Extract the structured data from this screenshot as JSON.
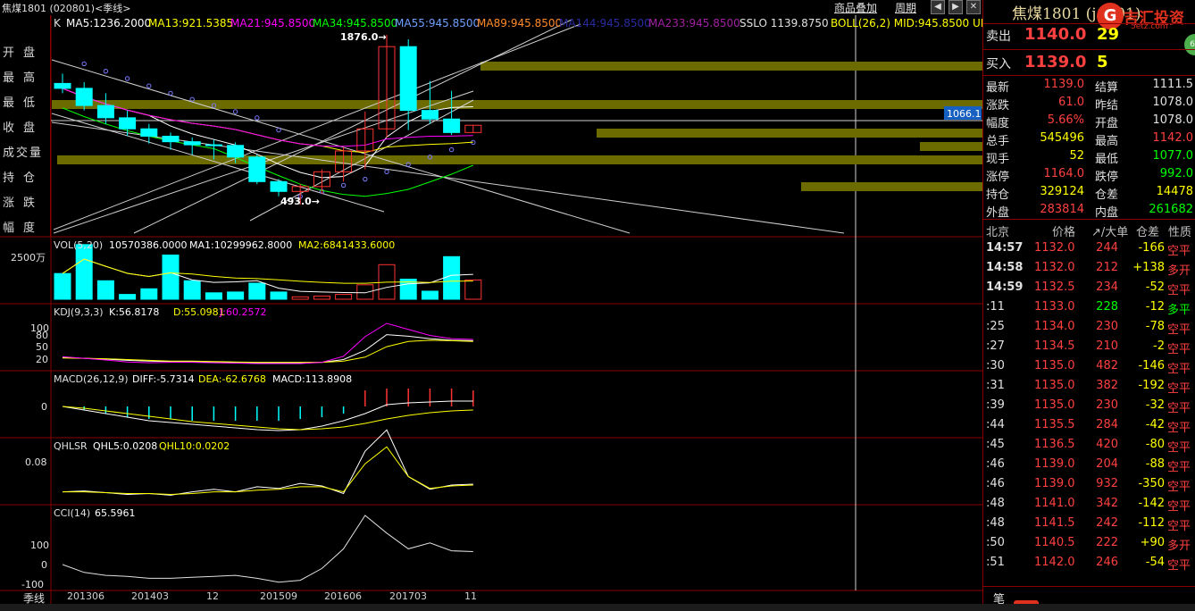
{
  "window": {
    "title": "焦煤1801 (020801)<季线>",
    "menu_overlay": "商品叠加",
    "menu_period": "周期",
    "btn_prev": "◀",
    "btn_next": "▶",
    "btn_close": "✕"
  },
  "main_indicator": {
    "k": "K",
    "ma5": "MA5:1236.2000",
    "ma13": "MA13:921.5385",
    "ma21": "MA21:945.8500",
    "ma34": "MA34:945.8500",
    "ma55": "MA55:945.8500",
    "ma89": "MA89:945.8500",
    "ma144": "MA144:945.8500",
    "ma233": "MA233:945.8500",
    "sslo": "SSLO 1139.8750",
    "boll": "BOLL(26,2) MID:945.8500 UPP"
  },
  "left_labels": [
    "开盘",
    "最高",
    "最低",
    "收盘",
    "成交量",
    "持仓",
    "涨跌",
    "幅度"
  ],
  "annotations": {
    "high": "1876.0→",
    "low": "493.0→",
    "price_tag": "1066.1"
  },
  "vol_panel": {
    "title": "VOL(5,20)",
    "vol": "10570386.0000",
    "ma1": "MA1:10299962.8000",
    "ma2": "MA2:6841433.6000",
    "axis": "2500万"
  },
  "kdj_panel": {
    "title": "KDJ(9,3,3)",
    "k": "K:56.8178",
    "d": "D:55.0981",
    "j": "J:60.2572",
    "ticks": [
      "100",
      "80",
      "50",
      "20"
    ]
  },
  "macd_panel": {
    "title": "MACD(26,12,9)",
    "diff": "DIFF:-5.7314",
    "dea": "DEA:-62.6768",
    "macd": "MACD:113.8908",
    "ticks": [
      "0"
    ]
  },
  "qhlsr_panel": {
    "title": "QHLSR",
    "qhl5": "QHL5:0.0208",
    "qhl10": "QHL10:0.0202",
    "ticks": [
      "0.08"
    ]
  },
  "cci_panel": {
    "title": "CCI(14)",
    "value": "65.5961",
    "ticks": [
      "100",
      "0",
      "-100"
    ]
  },
  "x_axis": {
    "tab": "季线",
    "labels": [
      "201306",
      "201403",
      "12",
      "201509",
      "201606",
      "201703",
      "11"
    ]
  },
  "quote": {
    "symbol": "焦煤1801 (j1801)",
    "logo_char": "G",
    "logo_text": "吉汇投资",
    "logo_sub": "5etz.com",
    "badge": "60",
    "sell_label": "卖出",
    "sell_price": "1140.0",
    "sell_vol": "29",
    "buy_label": "买入",
    "buy_price": "1139.0",
    "buy_vol": "5",
    "rows": [
      {
        "l1": "最新",
        "v1": "1139.0",
        "c1": "red",
        "l2": "结算",
        "v2": "1111.5",
        "c2": "white"
      },
      {
        "l1": "涨跌",
        "v1": "61.0",
        "c1": "red",
        "l2": "昨结",
        "v2": "1078.0",
        "c2": "white"
      },
      {
        "l1": "幅度",
        "v1": "5.66%",
        "c1": "red",
        "l2": "开盘",
        "v2": "1078.0",
        "c2": "white"
      },
      {
        "l1": "总手",
        "v1": "545496",
        "c1": "yellow",
        "l2": "最高",
        "v2": "1142.0",
        "c2": "red"
      },
      {
        "l1": "现手",
        "v1": "52",
        "c1": "yellow",
        "l2": "最低",
        "v2": "1077.0",
        "c2": "green"
      },
      {
        "l1": "涨停",
        "v1": "1164.0",
        "c1": "red",
        "l2": "跌停",
        "v2": "992.0",
        "c2": "green"
      },
      {
        "l1": "持仓",
        "v1": "329124",
        "c1": "yellow",
        "l2": "仓差",
        "v2": "14478",
        "c2": "yellow"
      },
      {
        "l1": "外盘",
        "v1": "283814",
        "c1": "red",
        "l2": "内盘",
        "v2": "261682",
        "c2": "green"
      }
    ]
  },
  "trades_header": {
    "place": "北京",
    "price": "价格",
    "vol": "↗/大单",
    "oi": "仓差",
    "type": "性质"
  },
  "trades": [
    {
      "time": "14:57",
      "price": "1132.0",
      "vol": "244",
      "vc": "red",
      "oi": "-166",
      "oc": "yellow",
      "type": "空平",
      "tc": "red"
    },
    {
      "time": "14:58",
      "price": "1132.0",
      "vol": "212",
      "vc": "red",
      "oi": "+138",
      "oc": "yellow",
      "type": "多开",
      "tc": "red"
    },
    {
      "time": "14:59",
      "price": "1132.5",
      "vol": "234",
      "vc": "red",
      "oi": "-52",
      "oc": "yellow",
      "type": "空平",
      "tc": "red"
    },
    {
      "time": ":11",
      "price": "1133.0",
      "vol": "228",
      "vc": "green",
      "oi": "-12",
      "oc": "yellow",
      "type": "多平",
      "tc": "green"
    },
    {
      "time": ":25",
      "price": "1134.0",
      "vol": "230",
      "vc": "red",
      "oi": "-78",
      "oc": "yellow",
      "type": "空平",
      "tc": "red"
    },
    {
      "time": ":27",
      "price": "1134.5",
      "vol": "210",
      "vc": "red",
      "oi": "-2",
      "oc": "yellow",
      "type": "空平",
      "tc": "red"
    },
    {
      "time": ":30",
      "price": "1135.0",
      "vol": "482",
      "vc": "red",
      "oi": "-146",
      "oc": "yellow",
      "type": "空平",
      "tc": "red"
    },
    {
      "time": ":31",
      "price": "1135.0",
      "vol": "382",
      "vc": "red",
      "oi": "-192",
      "oc": "yellow",
      "type": "空平",
      "tc": "red"
    },
    {
      "time": ":39",
      "price": "1135.0",
      "vol": "230",
      "vc": "red",
      "oi": "-32",
      "oc": "yellow",
      "type": "空平",
      "tc": "red"
    },
    {
      "time": ":44",
      "price": "1135.5",
      "vol": "284",
      "vc": "red",
      "oi": "-42",
      "oc": "yellow",
      "type": "空平",
      "tc": "red"
    },
    {
      "time": ":45",
      "price": "1136.5",
      "vol": "420",
      "vc": "red",
      "oi": "-80",
      "oc": "yellow",
      "type": "空平",
      "tc": "red"
    },
    {
      "time": ":46",
      "price": "1139.0",
      "vol": "204",
      "vc": "red",
      "oi": "-88",
      "oc": "yellow",
      "type": "空平",
      "tc": "red"
    },
    {
      "time": ":46",
      "price": "1139.0",
      "vol": "932",
      "vc": "red",
      "oi": "-350",
      "oc": "yellow",
      "type": "空平",
      "tc": "red"
    },
    {
      "time": ":48",
      "price": "1141.0",
      "vol": "342",
      "vc": "red",
      "oi": "-142",
      "oc": "yellow",
      "type": "空平",
      "tc": "red"
    },
    {
      "time": ":48",
      "price": "1141.5",
      "vol": "242",
      "vc": "red",
      "oi": "-112",
      "oc": "yellow",
      "type": "空平",
      "tc": "red"
    },
    {
      "time": ":50",
      "price": "1140.5",
      "vol": "222",
      "vc": "red",
      "oi": "+90",
      "oc": "yellow",
      "type": "多开",
      "tc": "red"
    },
    {
      "time": ":51",
      "price": "1142.0",
      "vol": "246",
      "vc": "red",
      "oi": "-54",
      "oc": "yellow",
      "type": "空平",
      "tc": "red"
    }
  ],
  "bottom_tab": "笔",
  "colors": {
    "up": "#ff3232",
    "down": "#00ffff",
    "ma5": "#ffffff",
    "ma13": "#ffff00",
    "ma21": "#ff00ff",
    "ma34": "#00ff00",
    "band": "#6b6b00",
    "divider": "#8a0000"
  },
  "chart_data": {
    "type": "candlestick",
    "quarters": [
      "2013Q2",
      "2013Q3",
      "2013Q4",
      "2014Q1",
      "2014Q2",
      "2014Q3",
      "2014Q4",
      "2015Q1",
      "2015Q2",
      "2015Q3",
      "2015Q4",
      "2016Q1",
      "2016Q2",
      "2016Q3",
      "2016Q4",
      "2017Q1",
      "2017Q2",
      "2017Q3",
      "2017Q4",
      "2018Q1"
    ],
    "open": [
      1480,
      1440,
      1300,
      1200,
      1110,
      1050,
      1005,
      980,
      975,
      880,
      680,
      600,
      640,
      760,
      930,
      1110,
      1780,
      1260,
      1190,
      1080
    ],
    "high": [
      1560,
      1490,
      1400,
      1260,
      1150,
      1080,
      1040,
      1020,
      1000,
      900,
      700,
      660,
      780,
      960,
      1250,
      1876,
      1840,
      1500,
      1420,
      1142
    ],
    "low": [
      1400,
      1260,
      1150,
      1050,
      990,
      940,
      900,
      860,
      830,
      660,
      560,
      493,
      580,
      680,
      780,
      1040,
      1100,
      1150,
      1060,
      1077
    ],
    "close": [
      1440,
      1300,
      1200,
      1110,
      1050,
      1005,
      980,
      975,
      880,
      680,
      600,
      640,
      760,
      930,
      1110,
      1780,
      1260,
      1190,
      1080,
      1139
    ],
    "ylim": [
      493,
      1876
    ]
  }
}
